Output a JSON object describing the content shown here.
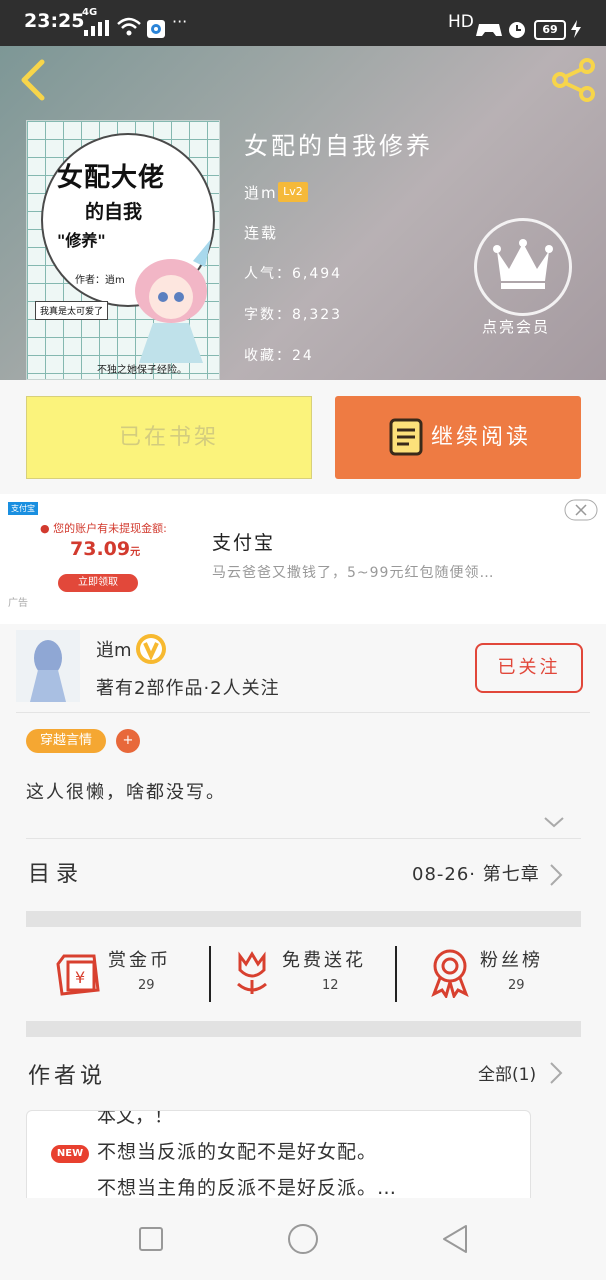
{
  "status_bar": {
    "time": "23:25",
    "network": "4G",
    "more": "···",
    "right_text": "HD",
    "battery": "69"
  },
  "book": {
    "title": "女配的自我修养",
    "author": "逍m",
    "level": "Lv2",
    "status": "连载",
    "popularity": "人气：6,494",
    "word_count": "字数：8,323",
    "favorites": "收藏：24",
    "cover_title_1": "女配大佬",
    "cover_title_2": "的自我",
    "cover_title_3": "\"修养\"",
    "cover_author": "作者：逍m",
    "cover_caption": "我真是太可爱了",
    "cover_bottom": "不独之她保子经险。"
  },
  "vip": {
    "label": "点亮会员"
  },
  "actions": {
    "shelf_label": "已在书架",
    "read_label": "继续阅读"
  },
  "ad": {
    "title": "支付宝",
    "desc": "马云爸爸又撒钱了，5~99元红包随便领…",
    "ad_label": "广告",
    "balance_text": "您的账户有未提现金额:",
    "amount": "73.09",
    "amount_unit": "元",
    "claim_label": "立即领取",
    "logo": "支付宝"
  },
  "author": {
    "name": "逍m",
    "stats": "著有2部作品·2人关注",
    "follow_label": "已关注",
    "tag": "穿越言情",
    "tag_add": "+",
    "bio": "这人很懒，啥都没写。"
  },
  "toc": {
    "label": "目录",
    "latest": "08-26· 第七章"
  },
  "stats": [
    {
      "label": "赏金币",
      "value": "29",
      "icon": "money-envelope-icon"
    },
    {
      "label": "免费送花",
      "value": "12",
      "icon": "flower-icon"
    },
    {
      "label": "粉丝榜",
      "value": "29",
      "icon": "medal-icon"
    }
  ],
  "author_says": {
    "label": "作者说",
    "all_label": "全部(1)",
    "new_badge": "NEW",
    "line0": "本文，！",
    "line1": "不想当反派的女配不是好女配。",
    "line2": "不想当主角的反派不是好反派。…"
  },
  "colors": {
    "accent_orange": "#ee7b43",
    "accent_red": "#e1473a",
    "tag_orange": "#f5a732",
    "share_yellow": "#f7d54a"
  }
}
